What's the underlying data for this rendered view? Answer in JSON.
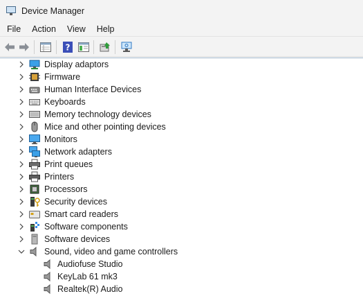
{
  "window": {
    "title": "Device Manager"
  },
  "menu": [
    "File",
    "Action",
    "View",
    "Help"
  ],
  "toolbar": {
    "buttons": [
      "back-icon",
      "forward-icon",
      "properties-grid-icon",
      "help-icon",
      "show-hide-console-tree-icon",
      "update-driver-icon",
      "scan-hardware-icon"
    ]
  },
  "tree": {
    "categories": [
      {
        "label": "Display adaptors",
        "icon": "display-adapter-icon",
        "expanded": false
      },
      {
        "label": "Firmware",
        "icon": "firmware-icon",
        "expanded": false
      },
      {
        "label": "Human Interface Devices",
        "icon": "hid-icon",
        "expanded": false
      },
      {
        "label": "Keyboards",
        "icon": "keyboard-icon",
        "expanded": false
      },
      {
        "label": "Memory technology devices",
        "icon": "memory-icon",
        "expanded": false
      },
      {
        "label": "Mice and other pointing devices",
        "icon": "mouse-icon",
        "expanded": false
      },
      {
        "label": "Monitors",
        "icon": "monitor-icon",
        "expanded": false
      },
      {
        "label": "Network adapters",
        "icon": "network-icon",
        "expanded": false
      },
      {
        "label": "Print queues",
        "icon": "print-queue-icon",
        "expanded": false
      },
      {
        "label": "Printers",
        "icon": "printer-icon",
        "expanded": false
      },
      {
        "label": "Processors",
        "icon": "processor-icon",
        "expanded": false
      },
      {
        "label": "Security devices",
        "icon": "security-device-icon",
        "expanded": false
      },
      {
        "label": "Smart card readers",
        "icon": "smart-card-icon",
        "expanded": false
      },
      {
        "label": "Software components",
        "icon": "software-component-icon",
        "expanded": false
      },
      {
        "label": "Software devices",
        "icon": "software-device-icon",
        "expanded": false
      },
      {
        "label": "Sound, video and game controllers",
        "icon": "speaker-icon",
        "expanded": true
      }
    ],
    "children": [
      {
        "label": "Audiofuse Studio",
        "icon": "speaker-icon"
      },
      {
        "label": "KeyLab 61 mk3",
        "icon": "speaker-icon"
      },
      {
        "label": "Realtek(R) Audio",
        "icon": "speaker-icon"
      }
    ]
  },
  "colors": {
    "chrome": "#f3f3f3",
    "accent": "#1e88e5",
    "text": "#1a1a1a"
  }
}
